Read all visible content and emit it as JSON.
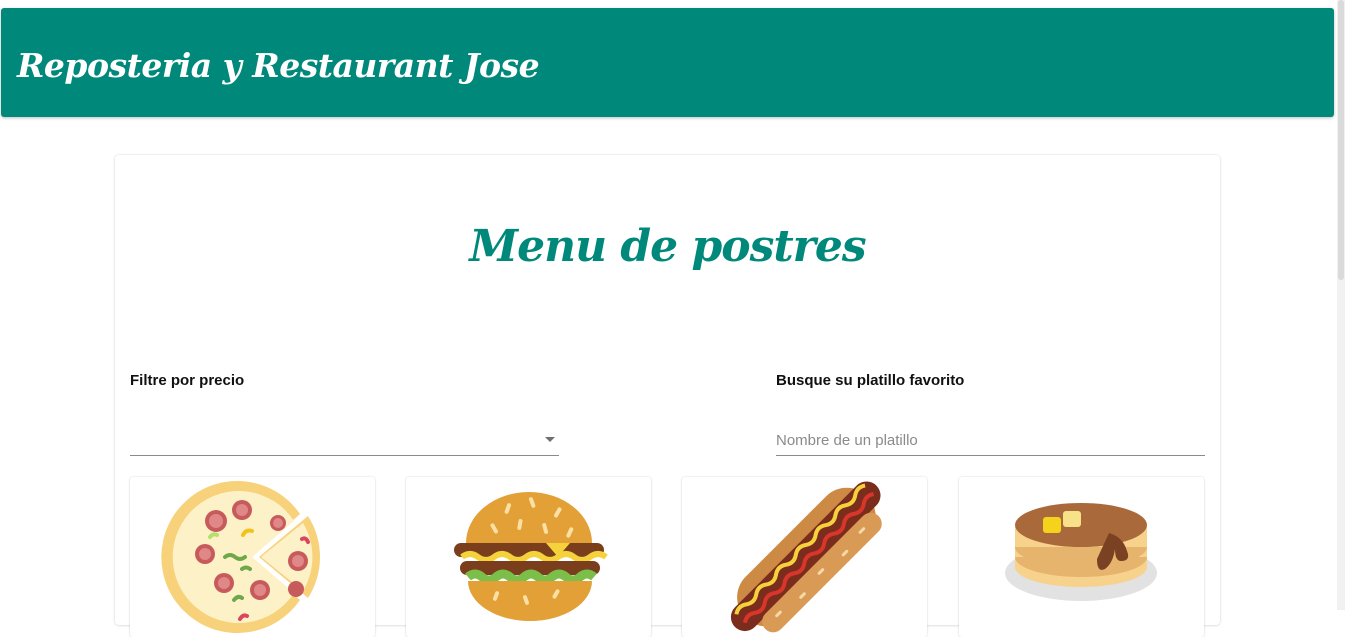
{
  "header": {
    "title": "Reposteria y Restaurant Jose"
  },
  "main": {
    "title": "Menu de postres",
    "price_filter": {
      "label": "Filtre por precio",
      "selected_value": ""
    },
    "search": {
      "label": "Busque su platillo favorito",
      "placeholder": "Nombre de un platillo",
      "value": ""
    },
    "dishes": [
      {
        "icon": "pizza-icon"
      },
      {
        "icon": "hamburger-icon"
      },
      {
        "icon": "hot-dog-icon"
      },
      {
        "icon": "pancakes-icon"
      }
    ]
  },
  "colors": {
    "primary": "#00897b",
    "background": "#ffffff"
  }
}
